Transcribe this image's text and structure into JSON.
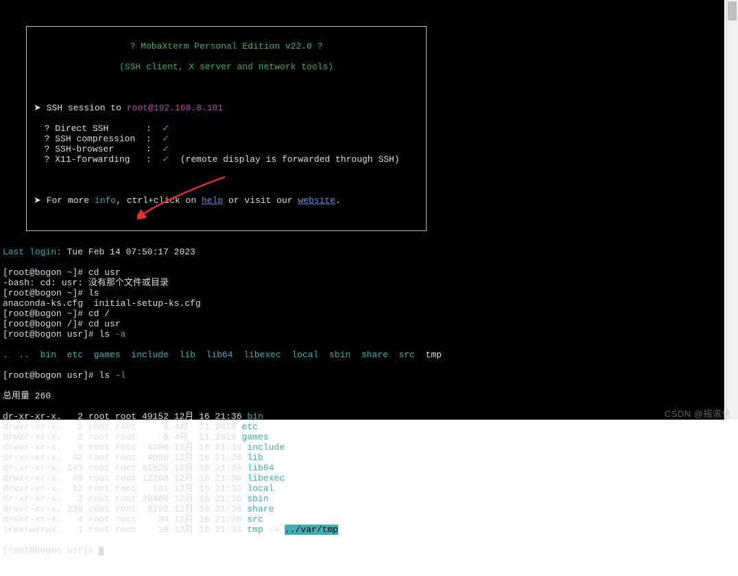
{
  "banner": {
    "title_line": "? MobaXterm Personal Edition v22.0 ?",
    "subtitle": "(SSH client, X server and network tools)",
    "session_prefix": "➤ SSH session to ",
    "session_target": "root@192.168.8.101",
    "rows": [
      {
        "label": "? Direct SSH       :  ",
        "mark": "✓"
      },
      {
        "label": "? SSH compression  :  ",
        "mark": "✓"
      },
      {
        "label": "? SSH-browser      :  ",
        "mark": "✓"
      },
      {
        "label": "? X11-forwarding   :  ",
        "mark": "✓",
        "note": "  (remote display is forwarded through SSH)"
      }
    ],
    "more_prefix": "➤ For more ",
    "info": "info",
    "ctrl": ", ctrl+click on ",
    "help": "help",
    "or": " or visit our ",
    "website": "website",
    "dot": "."
  },
  "session": {
    "last_login_label": "Last login:",
    "last_login_val": " Tue Feb 14 07:50:17 2023",
    "lines": [
      {
        "prompt": "[root@bogon ~]# ",
        "cmd": "cd usr"
      },
      {
        "plain": "-bash: cd: usr: 没有那个文件或目录"
      },
      {
        "prompt": "[root@bogon ~]# ",
        "cmd": "ls"
      },
      {
        "plain": "anaconda-ks.cfg  initial-setup-ks.cfg"
      },
      {
        "prompt": "[root@bogon ~]# ",
        "cmd": "cd /"
      },
      {
        "prompt": "[root@bogon /]# ",
        "cmd": "cd usr"
      },
      {
        "prompt": "[root@bogon usr]# ",
        "cmd": "ls ",
        "flag": "-a"
      }
    ],
    "ls_a": [
      ".",
      "..",
      "bin",
      "etc",
      "games",
      "include",
      "lib",
      "lib64",
      "libexec",
      "local",
      "sbin",
      "share",
      "src",
      "tmp"
    ],
    "ls_l_prompt": "[root@bogon usr]# ",
    "ls_l_cmd": "ls ",
    "ls_l_flag": "-l",
    "total": "总用量 260",
    "entries": [
      {
        "perm": "dr-xr-xr-x.",
        "n": "  2",
        "o": "root root",
        "sz": "49152",
        "dt": "12月 16 21:36",
        "name": "bin",
        "cls": "c-dir"
      },
      {
        "perm": "drwxr-xr-x.",
        "n": "  2",
        "o": "root root",
        "sz": "    6",
        "dt": "4月  11 2018",
        "name": "etc",
        "cls": "c-dir"
      },
      {
        "perm": "drwxr-xr-x.",
        "n": "  2",
        "o": "root root",
        "sz": "    6",
        "dt": "4月  11 2018",
        "name": "games",
        "cls": "c-dir"
      },
      {
        "perm": "drwxr-xr-x.",
        "n": "  9",
        "o": "root root",
        "sz": " 4096",
        "dt": "12月 16 21:36",
        "name": "include",
        "cls": "c-dir"
      },
      {
        "perm": "dr-xr-xr-x.",
        "n": " 42",
        "o": "root root",
        "sz": " 4096",
        "dt": "12月 16 21:36",
        "name": "lib",
        "cls": "c-dir"
      },
      {
        "perm": "dr-xr-xr-x.",
        "n": "145",
        "o": "root root",
        "sz": "81920",
        "dt": "12月 16 21:39",
        "name": "lib64",
        "cls": "c-dir"
      },
      {
        "perm": "drwxr-xr-x.",
        "n": " 49",
        "o": "root root",
        "sz": "12288",
        "dt": "12月 16 21:36",
        "name": "libexec",
        "cls": "c-dir"
      },
      {
        "perm": "drwxr-xr-x.",
        "n": " 12",
        "o": "root root",
        "sz": "  131",
        "dt": "12月 16 21:33",
        "name": "local",
        "cls": "c-dir"
      },
      {
        "perm": "dr-xr-xr-x.",
        "n": "  2",
        "o": "root root",
        "sz": "20480",
        "dt": "12月 16 21:36",
        "name": "sbin",
        "cls": "c-dir"
      },
      {
        "perm": "drwxr-xr-x.",
        "n": "239",
        "o": "root root",
        "sz": " 8192",
        "dt": "12月 16 21:36",
        "name": "share",
        "cls": "c-dir"
      },
      {
        "perm": "drwxr-xr-x.",
        "n": "  4",
        "o": "root root",
        "sz": "   34",
        "dt": "12月 16 21:36",
        "name": "src",
        "cls": "c-dir"
      },
      {
        "perm": "lrwxrwxrwx.",
        "n": "  1",
        "o": "root root",
        "sz": "   10",
        "dt": "12月 16 21:33",
        "name": "tmp",
        "cls": "c-dir",
        "arrow": " -> ",
        "target": "../var/tmp"
      }
    ],
    "final_prompt": "[root@bogon usr]# "
  },
  "watermark": "CSDN @摇滚侠"
}
